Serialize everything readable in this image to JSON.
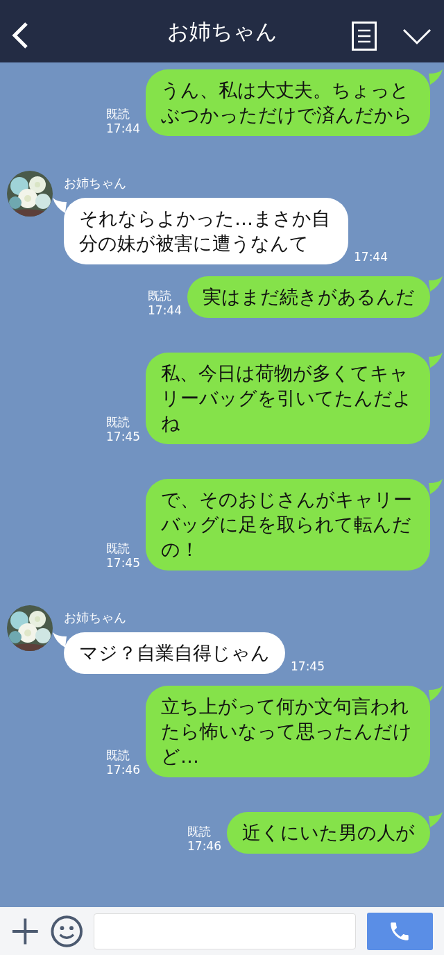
{
  "header": {
    "title": "お姉ちゃん"
  },
  "messages": [
    {
      "kind": "sent",
      "text": "うん、私は大丈夫。ちょっとぶつかっただけで済んだから",
      "read": "既読",
      "time": "17:44"
    },
    {
      "kind": "received",
      "sender": "お姉ちゃん",
      "text": "それならよかった…まさか自分の妹が被害に遭うなんて",
      "time": "17:44"
    },
    {
      "kind": "sent",
      "text": "実はまだ続きがあるんだ",
      "read": "既読",
      "time": "17:44"
    },
    {
      "kind": "sent",
      "text": "私、今日は荷物が多くてキャリーバッグを引いてたんだよね",
      "read": "既読",
      "time": "17:45"
    },
    {
      "kind": "sent",
      "text": "で、そのおじさんがキャリーバッグに足を取られて転んだの！",
      "read": "既読",
      "time": "17:45"
    },
    {
      "kind": "received",
      "sender": "お姉ちゃん",
      "text": "マジ？自業自得じゃん",
      "time": "17:45"
    },
    {
      "kind": "sent",
      "text": "立ち上がって何か文句言われたら怖いなって思ったんだけど…",
      "read": "既読",
      "time": "17:46"
    },
    {
      "kind": "sent",
      "text": "近くにいた男の人が",
      "read": "既読",
      "time": "17:46"
    }
  ]
}
